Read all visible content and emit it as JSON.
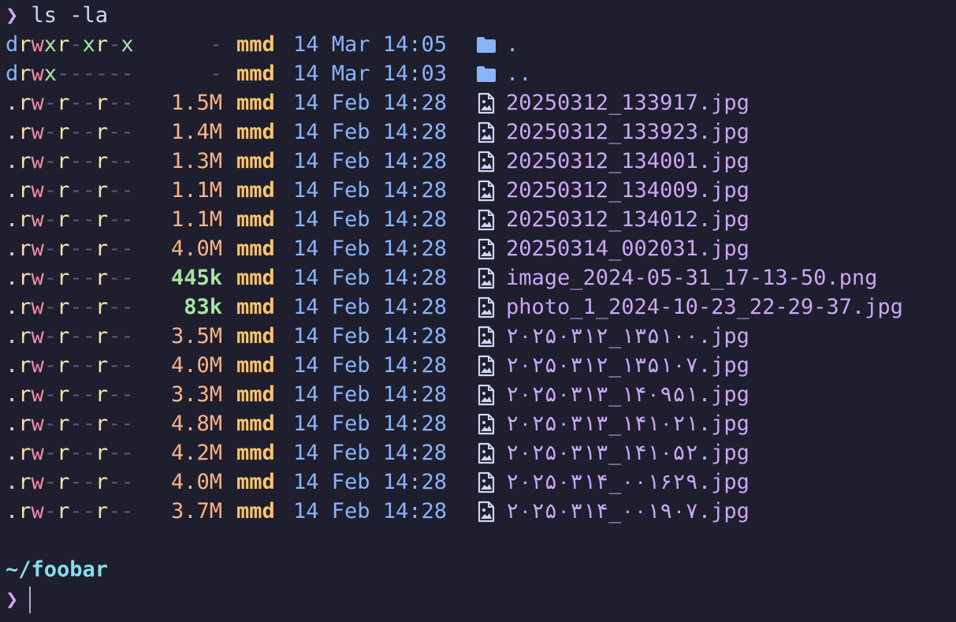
{
  "prompt": {
    "symbol": "❯",
    "command": "ls -la"
  },
  "entries": [
    {
      "perm": "drwxr-xr-x",
      "size": "-",
      "user": "mmd",
      "date": "14 Mar 14:05",
      "icon": "folder-icon",
      "name": "."
    },
    {
      "perm": "drwx------",
      "size": "-",
      "user": "mmd",
      "date": "14 Mar 14:03",
      "icon": "folder-icon",
      "name": ".."
    },
    {
      "perm": ".rw-r--r--",
      "size": "1.5M",
      "user": "mmd",
      "date": "14 Feb 14:28",
      "icon": "image-file-icon",
      "name": "20250312_133917.jpg"
    },
    {
      "perm": ".rw-r--r--",
      "size": "1.4M",
      "user": "mmd",
      "date": "14 Feb 14:28",
      "icon": "image-file-icon",
      "name": "20250312_133923.jpg"
    },
    {
      "perm": ".rw-r--r--",
      "size": "1.3M",
      "user": "mmd",
      "date": "14 Feb 14:28",
      "icon": "image-file-icon",
      "name": "20250312_134001.jpg"
    },
    {
      "perm": ".rw-r--r--",
      "size": "1.1M",
      "user": "mmd",
      "date": "14 Feb 14:28",
      "icon": "image-file-icon",
      "name": "20250312_134009.jpg"
    },
    {
      "perm": ".rw-r--r--",
      "size": "1.1M",
      "user": "mmd",
      "date": "14 Feb 14:28",
      "icon": "image-file-icon",
      "name": "20250312_134012.jpg"
    },
    {
      "perm": ".rw-r--r--",
      "size": "4.0M",
      "user": "mmd",
      "date": "14 Feb 14:28",
      "icon": "image-file-icon",
      "name": "20250314_002031.jpg"
    },
    {
      "perm": ".rw-r--r--",
      "size": "445k",
      "user": "mmd",
      "date": "14 Feb 14:28",
      "icon": "image-file-icon",
      "name": "image_2024-05-31_17-13-50.png"
    },
    {
      "perm": ".rw-r--r--",
      "size": "83k",
      "user": "mmd",
      "date": "14 Feb 14:28",
      "icon": "image-file-icon",
      "name": "photo_1_2024-10-23_22-29-37.jpg"
    },
    {
      "perm": ".rw-r--r--",
      "size": "3.5M",
      "user": "mmd",
      "date": "14 Feb 14:28",
      "icon": "image-file-icon",
      "name": "۲۰۲۵۰۳۱۲_۱۳۵۱۰۰.jpg"
    },
    {
      "perm": ".rw-r--r--",
      "size": "4.0M",
      "user": "mmd",
      "date": "14 Feb 14:28",
      "icon": "image-file-icon",
      "name": "۲۰۲۵۰۳۱۲_۱۳۵۱۰۷.jpg"
    },
    {
      "perm": ".rw-r--r--",
      "size": "3.3M",
      "user": "mmd",
      "date": "14 Feb 14:28",
      "icon": "image-file-icon",
      "name": "۲۰۲۵۰۳۱۳_۱۴۰۹۵۱.jpg"
    },
    {
      "perm": ".rw-r--r--",
      "size": "4.8M",
      "user": "mmd",
      "date": "14 Feb 14:28",
      "icon": "image-file-icon",
      "name": "۲۰۲۵۰۳۱۳_۱۴۱۰۲۱.jpg"
    },
    {
      "perm": ".rw-r--r--",
      "size": "4.2M",
      "user": "mmd",
      "date": "14 Feb 14:28",
      "icon": "image-file-icon",
      "name": "۲۰۲۵۰۳۱۳_۱۴۱۰۵۲.jpg"
    },
    {
      "perm": ".rw-r--r--",
      "size": "4.0M",
      "user": "mmd",
      "date": "14 Feb 14:28",
      "icon": "image-file-icon",
      "name": "۲۰۲۵۰۳۱۴_۰۰۱۶۲۹.jpg"
    },
    {
      "perm": ".rw-r--r--",
      "size": "3.7M",
      "user": "mmd",
      "date": "14 Feb 14:28",
      "icon": "image-file-icon",
      "name": "۲۰۲۵۰۳۱۴_۰۰۱۹۰۷.jpg"
    }
  ],
  "cwd": "~/foobar",
  "colors": {
    "background": "#1e1e2e",
    "prompt": "#cba6f7",
    "size": "#fab387",
    "size_small": "#a6e3a1",
    "user": "#f9c46b",
    "date": "#89b4fa",
    "filename": "#cba6f7",
    "cwd": "#89dceb"
  }
}
